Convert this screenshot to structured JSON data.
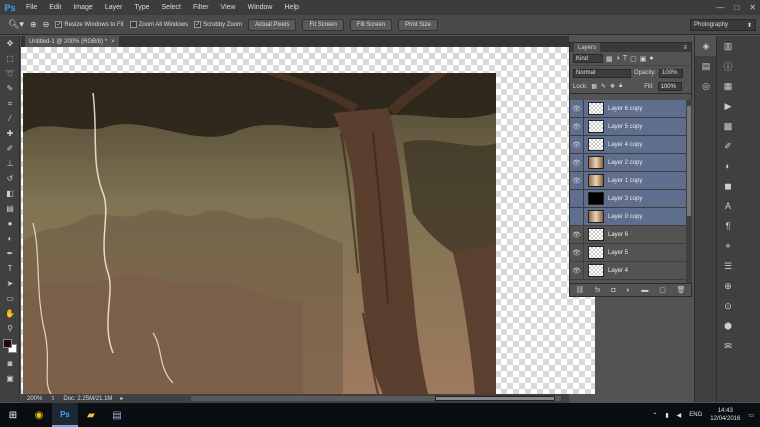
{
  "app": {
    "logo": "Ps"
  },
  "menu": [
    "File",
    "Edit",
    "Image",
    "Layer",
    "Type",
    "Select",
    "Filter",
    "View",
    "Window",
    "Help"
  ],
  "window_controls": {
    "minimize": "—",
    "maximize": "□",
    "close": "✕"
  },
  "options": {
    "resize_label": "Resize Windows to Fit",
    "zoom_all_label": "Zoom All Windows",
    "scrubby_label": "Scrubby Zoom",
    "actual_pixels": "Actual Pixels",
    "fit_screen": "Fit Screen",
    "fill_screen": "Fill Screen",
    "print_size": "Print Size",
    "resize_checked": true,
    "zoom_all_checked": false,
    "scrubby_checked": true
  },
  "workspace": {
    "value": "Photography"
  },
  "document": {
    "tab_title": "Untitled-1 @ 200% (RGB/8) *",
    "close": "×"
  },
  "status": {
    "zoom": "200%",
    "doc": "Doc: 2.25M/21.1M"
  },
  "layers_panel": {
    "title": "Layers",
    "filter_kind": "Kind",
    "blend_mode": "Normal",
    "opacity_label": "Opacity:",
    "opacity_value": "100%",
    "lock_label": "Lock:",
    "fill_label": "Fill:",
    "fill_value": "100%",
    "layers": [
      {
        "name": "Layer 6 copy",
        "selected": true,
        "visible": true,
        "thumb": "empty"
      },
      {
        "name": "Layer 5 copy",
        "selected": true,
        "visible": true,
        "thumb": "empty"
      },
      {
        "name": "Layer 4 copy",
        "selected": true,
        "visible": true,
        "thumb": "empty"
      },
      {
        "name": "Layer 2 copy",
        "selected": true,
        "visible": true,
        "thumb": "photo"
      },
      {
        "name": "Layer 1 copy",
        "selected": true,
        "visible": true,
        "thumb": "photo"
      },
      {
        "name": "Layer 3 copy",
        "selected": true,
        "visible": false,
        "thumb": "black"
      },
      {
        "name": "Layer 0 copy",
        "selected": true,
        "visible": false,
        "thumb": "photo"
      },
      {
        "name": "Layer 6",
        "selected": false,
        "visible": true,
        "thumb": "empty"
      },
      {
        "name": "Layer 5",
        "selected": false,
        "visible": true,
        "thumb": "empty"
      },
      {
        "name": "Layer 4",
        "selected": false,
        "visible": true,
        "thumb": "empty"
      }
    ]
  },
  "taskbar": {
    "lang": "ENG",
    "time": "14:43",
    "date": "12/04/2016"
  },
  "colors": {
    "selection": "#5e6e8c",
    "foreground": "#220909",
    "background": "#ffffff"
  }
}
